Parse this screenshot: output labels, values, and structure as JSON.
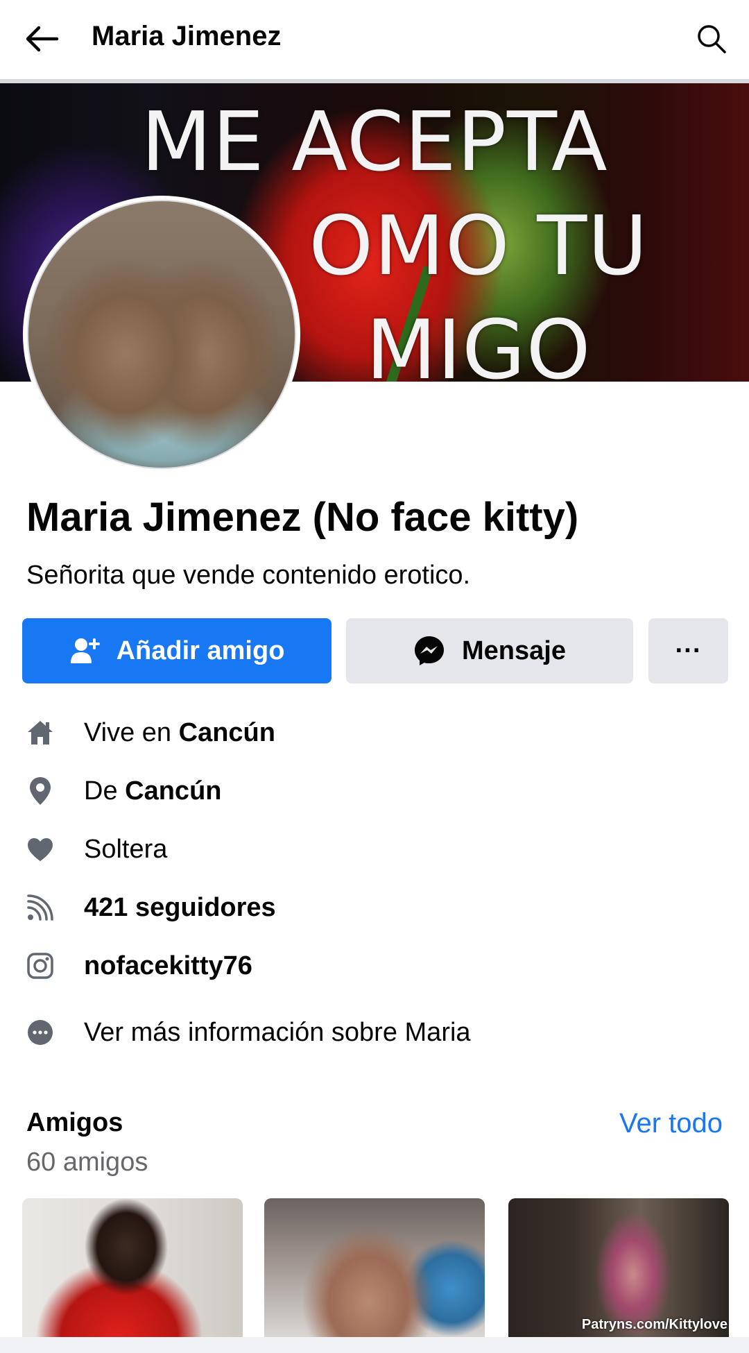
{
  "header": {
    "title": "Maria Jimenez"
  },
  "cover": {
    "line1": "ME ACEPTA",
    "line2": "OMO TU",
    "line3": "MIGO"
  },
  "profile": {
    "name": "Maria Jimenez (No face kitty)",
    "bio": "Señorita que vende contenido erotico."
  },
  "actions": {
    "add_friend": "Añadir amigo",
    "message": "Mensaje",
    "more": "···"
  },
  "info": {
    "lives_prefix": "Vive en ",
    "lives_city": "Cancún",
    "from_prefix": "De ",
    "from_city": "Cancún",
    "relationship": "Soltera",
    "followers": "421 seguidores",
    "instagram": "nofacekitty76",
    "more_info": "Ver más información sobre Maria"
  },
  "friends": {
    "title": "Amigos",
    "count": "60 amigos",
    "see_all": "Ver todo",
    "watermark": "Patryns.com/Kittylove"
  },
  "colors": {
    "accent": "#1877f2",
    "secondary_button": "#e4e6eb",
    "muted_text": "#65676b",
    "icon": "#606770"
  }
}
